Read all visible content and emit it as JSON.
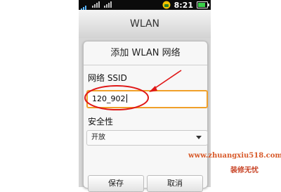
{
  "status_bar": {
    "time": "8:21"
  },
  "screen": {
    "title": "WLAN"
  },
  "dialog": {
    "title": "添加 WLAN 网络",
    "ssid": {
      "label": "网络 SSID",
      "value": "120_902"
    },
    "security": {
      "label": "安全性",
      "selected": "开放"
    },
    "buttons": {
      "save": "保存",
      "cancel": "取消"
    }
  },
  "watermark": {
    "url": "www.zhuangxiu518.com",
    "name": "装修无忧"
  },
  "colors": {
    "input_focus": "#f0a02a",
    "annotation": "#e01818",
    "watermark": "#d85a2a"
  }
}
